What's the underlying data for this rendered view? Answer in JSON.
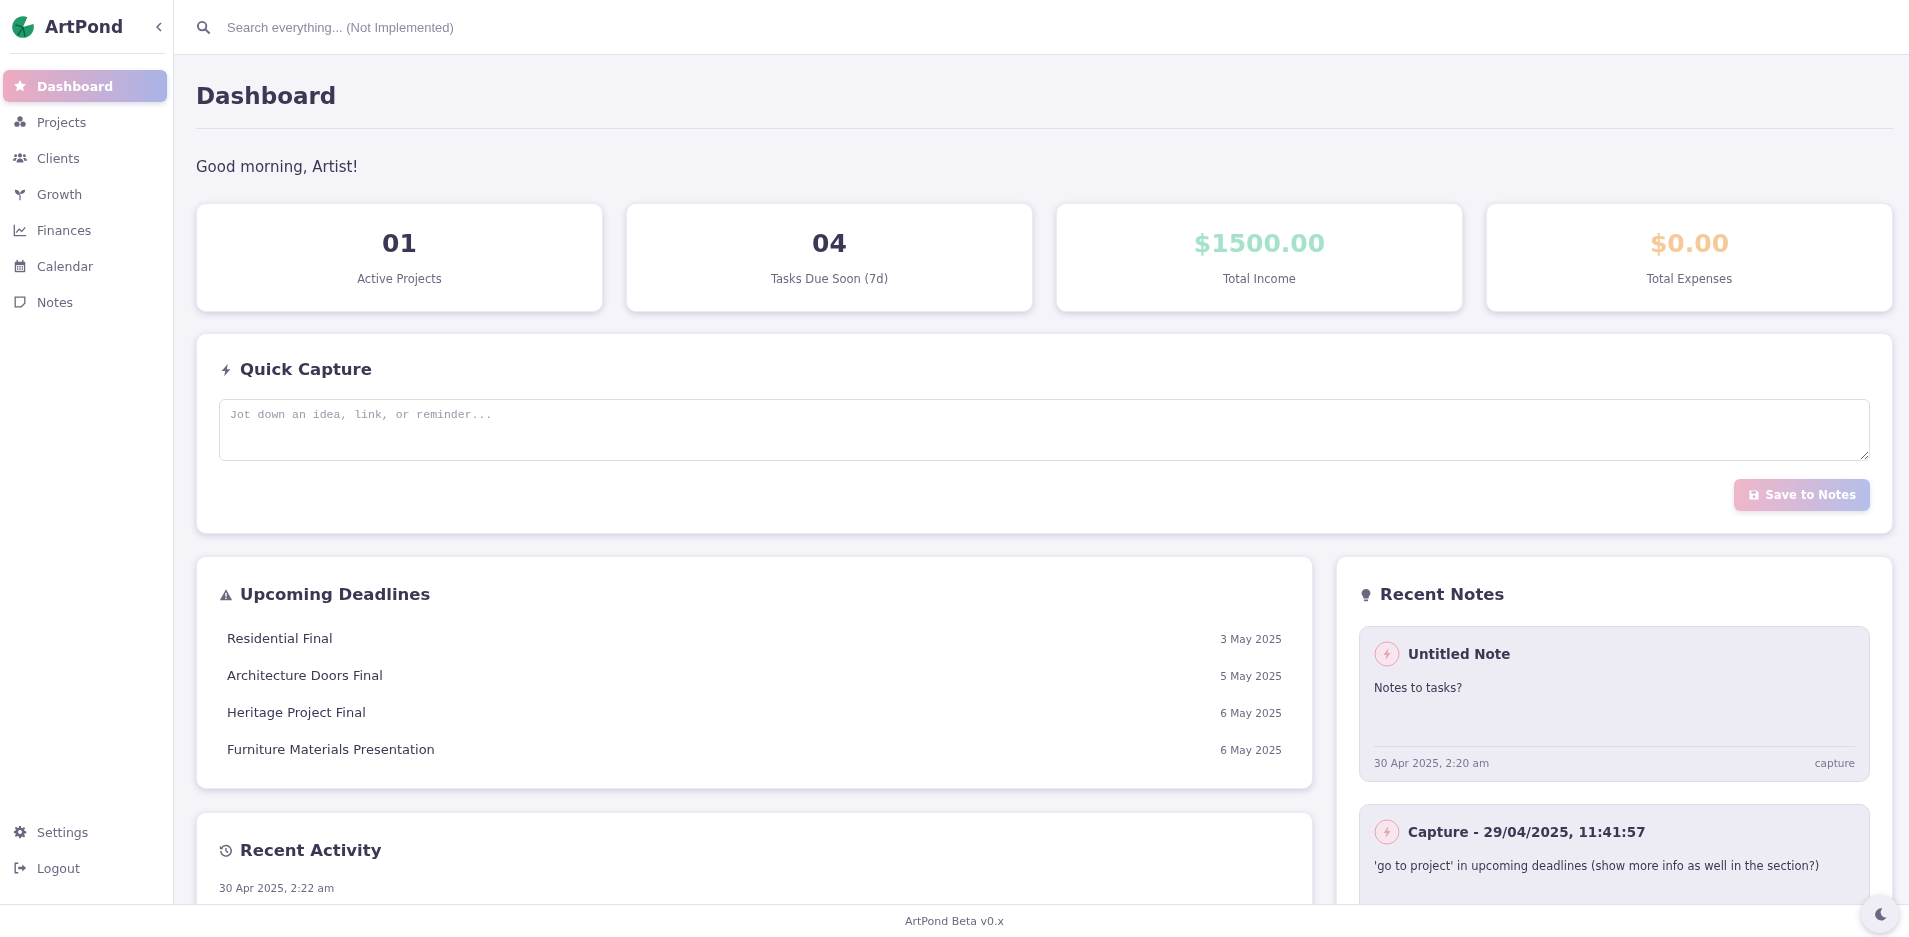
{
  "app": {
    "name": "ArtPond"
  },
  "sidebar": {
    "items": [
      {
        "label": "Dashboard",
        "selected": true
      },
      {
        "label": "Projects",
        "selected": false
      },
      {
        "label": "Clients",
        "selected": false
      },
      {
        "label": "Growth",
        "selected": false
      },
      {
        "label": "Finances",
        "selected": false
      },
      {
        "label": "Calendar",
        "selected": false
      },
      {
        "label": "Notes",
        "selected": false
      }
    ],
    "bottom_items": [
      {
        "label": "Settings"
      },
      {
        "label": "Logout"
      }
    ]
  },
  "search": {
    "placeholder": "Search everything... (Not Implemented)"
  },
  "page": {
    "title": "Dashboard",
    "greeting": "Good morning, Artist!"
  },
  "stats": [
    {
      "value": "01",
      "label": "Active Projects",
      "kind": "count"
    },
    {
      "value": "04",
      "label": "Tasks Due Soon (7d)",
      "kind": "count"
    },
    {
      "value": "$1500.00",
      "label": "Total Income",
      "kind": "income"
    },
    {
      "value": "$0.00",
      "label": "Total Expenses",
      "kind": "expense"
    }
  ],
  "quick_capture": {
    "title": "Quick Capture",
    "placeholder": "Jot down an idea, link, or reminder...",
    "button": "Save to Notes",
    "disabled": true
  },
  "deadlines": {
    "title": "Upcoming Deadlines",
    "items": [
      {
        "name": "Residential Final",
        "date": "3 May 2025"
      },
      {
        "name": "Architecture Doors Final",
        "date": "5 May 2025"
      },
      {
        "name": "Heritage Project Final",
        "date": "6 May 2025"
      },
      {
        "name": "Furniture Materials Presentation",
        "date": "6 May 2025"
      }
    ]
  },
  "activity": {
    "title": "Recent Activity",
    "items": [
      {
        "time": "30 Apr 2025, 2:22 am"
      }
    ]
  },
  "notes": {
    "title": "Recent Notes",
    "items": [
      {
        "title": "Untitled Note",
        "body": "Notes to tasks?",
        "date": "30 Apr 2025, 2:20 am",
        "tag": "capture"
      },
      {
        "title": "Capture - 29/04/2025, 11:41:57",
        "body": "'go to project' in upcoming deadlines (show more info as well in the section?)"
      }
    ]
  },
  "footer": "ArtPond Beta v0.x"
}
